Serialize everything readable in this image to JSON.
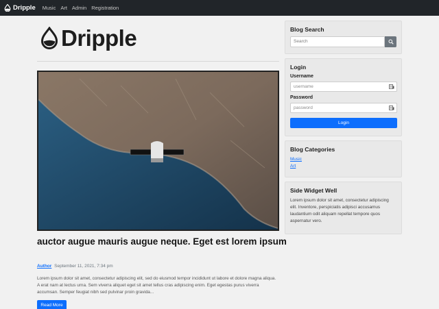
{
  "navbar": {
    "brand": "Dripple",
    "links": [
      "Music",
      "Art",
      "Admin",
      "Registration"
    ]
  },
  "logo": {
    "text": "Dripple"
  },
  "post": {
    "title": "auctor augue mauris augue neque. Eget est lorem ipsum",
    "author": "Author",
    "date": "September 11, 2021, 7:34 pm",
    "excerpt": "Lorem ipsum dolor sit amet, consectetur adipiscing elit, sed do eiusmod tempor incididunt ut labore et dolore magna aliqua. A erat nam at lectus urna. Sem viverra aliquet eget sit amet tellus cras adipiscing enim. Eget egestas purus viverra accumsan. Semper feugiat nibh sed pulvinar proin gravida...",
    "read_more": "Read More"
  },
  "sidebar": {
    "search": {
      "title": "Blog Search",
      "placeholder": "Search"
    },
    "login": {
      "title": "Login",
      "username_label": "Username",
      "username_placeholder": "username",
      "password_label": "Password",
      "password_placeholder": "password",
      "button": "Login"
    },
    "categories": {
      "title": "Blog Categories",
      "items": [
        "Music",
        "Art"
      ]
    },
    "widget": {
      "title": "Side Widget Well",
      "text": "Lorem ipsum dolor sit amet, consectetur adipiscing elit. Inventore, perspiciatis adipisci accusamus laudantium odit aliquam repellat tempore quos aspernatur vero."
    }
  },
  "colors": {
    "navbar": "#212529",
    "primary": "#0d6efd",
    "secondary": "#6c757d",
    "background": "#f1f1f1",
    "card": "#e9e9e9"
  }
}
